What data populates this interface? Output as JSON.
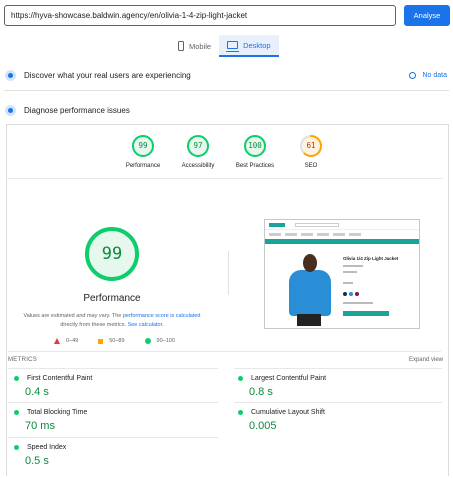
{
  "url_input": {
    "value": "https://hyva-showcase.baldwin.agency/en/olivia-1-4-zip-light-jacket"
  },
  "analyse_label": "Analyse",
  "device_tabs": [
    {
      "label": "Mobile",
      "icon": "phone-icon",
      "active": false
    },
    {
      "label": "Desktop",
      "icon": "desktop-icon",
      "active": true
    }
  ],
  "field_data": {
    "title": "Discover what your real users are experiencing",
    "no_data_label": "No data"
  },
  "diagnose": {
    "title": "Diagnose performance issues"
  },
  "categories": [
    {
      "name": "Performance",
      "score": "99",
      "score_value": 99,
      "color": "#0cce6b"
    },
    {
      "name": "Accessibility",
      "score": "97",
      "score_value": 97,
      "color": "#0cce6b"
    },
    {
      "name": "Best Practices",
      "score": "100",
      "score_value": 100,
      "color": "#0cce6b"
    },
    {
      "name": "SEO",
      "score": "61",
      "score_value": 61,
      "color": "#ffa400"
    }
  ],
  "performance": {
    "score": "99",
    "score_value": 99,
    "title": "Performance",
    "note_before": "Values are estimated and may vary. The ",
    "note_link1": "performance score is calculated",
    "note_mid": " directly from these metrics. ",
    "note_link2": "See calculator",
    "note_end": "."
  },
  "legend": {
    "fail": "0–49",
    "average": "50–89",
    "pass": "90–100"
  },
  "screenshot": {
    "product_title": "Olivia 1/4 Zip Light Jacket"
  },
  "metrics": {
    "label": "METRICS",
    "expand_label": "Expand view",
    "items": [
      {
        "name": "First Contentful Paint",
        "value": "0.4 s"
      },
      {
        "name": "Largest Contentful Paint",
        "value": "0.8 s"
      },
      {
        "name": "Total Blocking Time",
        "value": "70 ms"
      },
      {
        "name": "Cumulative Layout Shift",
        "value": "0.005"
      },
      {
        "name": "Speed Index",
        "value": "0.5 s"
      }
    ]
  },
  "colors": {
    "accent": "#1a73e8",
    "pass": "#0cce6b",
    "average": "#ffa400",
    "fail": "#e53935"
  }
}
